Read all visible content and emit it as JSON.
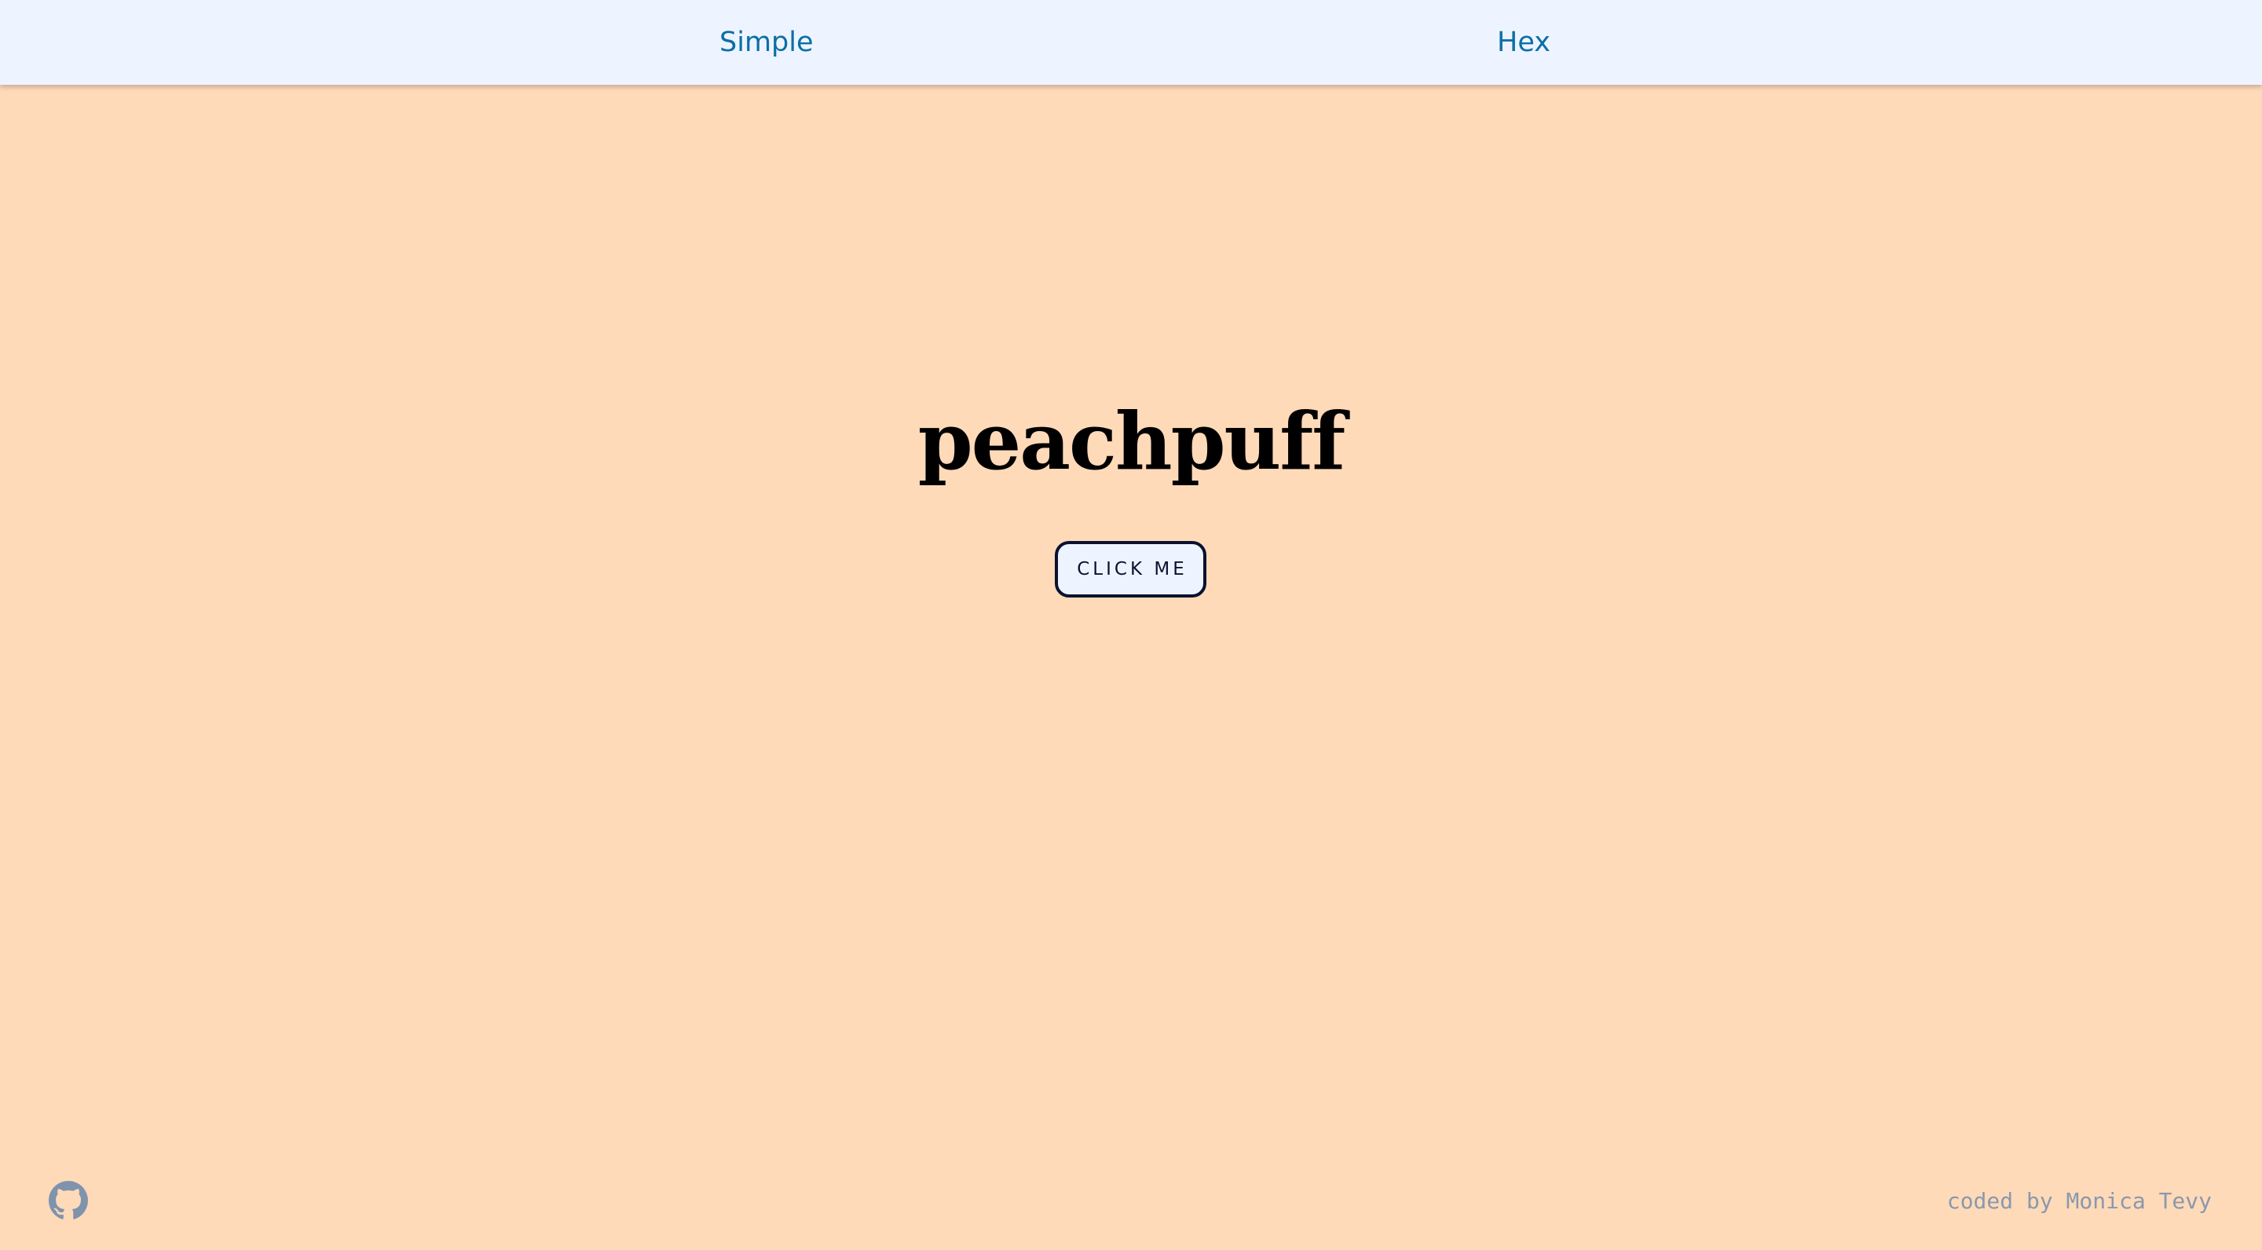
{
  "nav": {
    "items": [
      {
        "label": "Simple"
      },
      {
        "label": "Hex"
      }
    ]
  },
  "main": {
    "color_name": "peachpuff",
    "button_label": "CLICK ME",
    "background_color": "#ffdab9"
  },
  "footer": {
    "github_icon": "github-icon",
    "credit": "coded by Monica Tevy"
  },
  "colors": {
    "navbar_bg": "#eef4ff",
    "nav_link": "#0b6fa6",
    "button_border": "#0a1230",
    "footer_text": "#8a98ad"
  }
}
